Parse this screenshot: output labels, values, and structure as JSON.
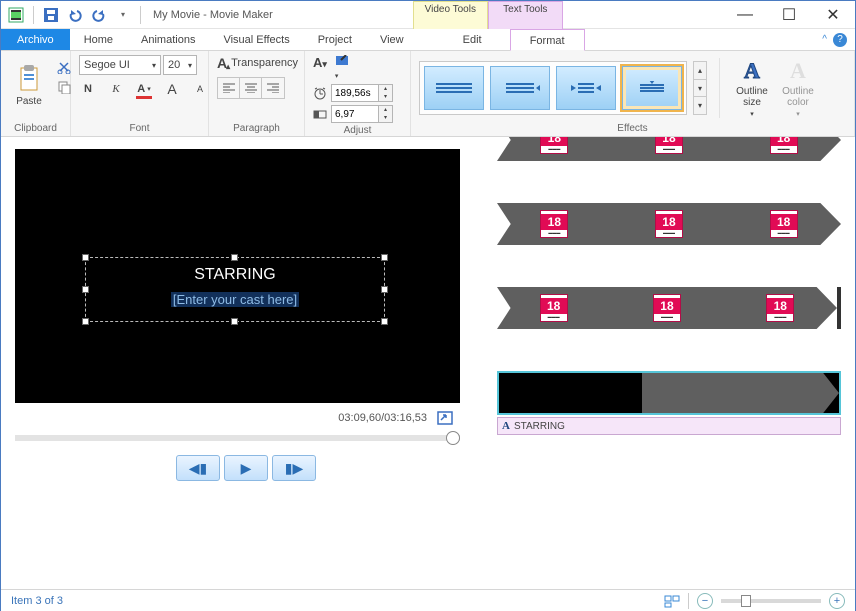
{
  "title": "My Movie - Movie Maker",
  "context_tools": {
    "video": "Video Tools",
    "text": "Text Tools"
  },
  "tabs": {
    "file": "Archivo",
    "home": "Home",
    "animations": "Animations",
    "visual_effects": "Visual Effects",
    "project": "Project",
    "view": "View",
    "edit": "Edit",
    "format": "Format"
  },
  "ribbon": {
    "clipboard": {
      "label": "Clipboard",
      "paste": "Paste"
    },
    "font": {
      "label": "Font",
      "family": "Segoe UI",
      "size": "20",
      "bold": "N",
      "italic": "K",
      "font_color_glyph": "A",
      "grow_glyph": "A",
      "transparency": "Transparency"
    },
    "paragraph": {
      "label": "Paragraph"
    },
    "adjust": {
      "label": "Adjust",
      "duration": "189,56s",
      "start": "6,97"
    },
    "effects": {
      "label": "Effects"
    },
    "outline_size": "Outline\nsize",
    "outline_color": "Outline\ncolor"
  },
  "preview": {
    "title_text": "STARRING",
    "placeholder": "[Enter your cast here]",
    "time_current": "03:09,60",
    "time_total": "03:16,53"
  },
  "timeline": {
    "badge": "18",
    "caption": "STARRING"
  },
  "status": {
    "item": "Item 3 of 3"
  }
}
